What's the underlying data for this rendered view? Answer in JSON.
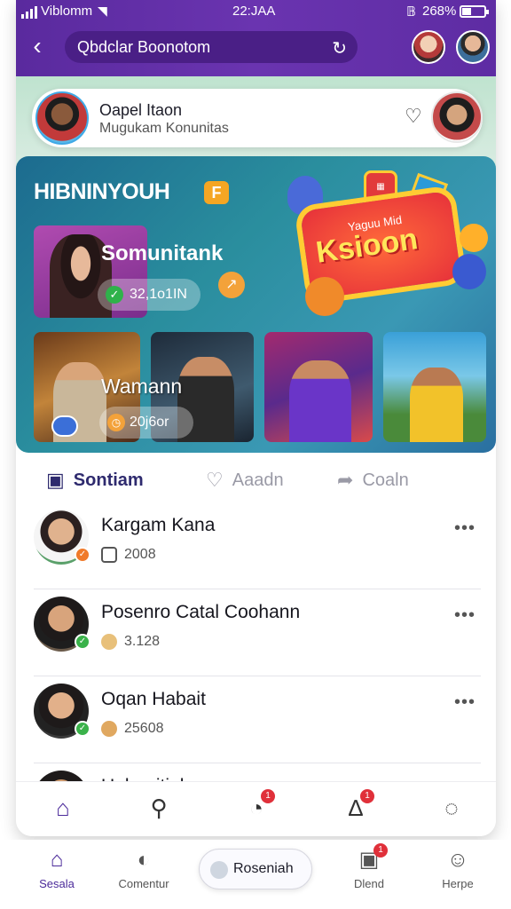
{
  "status": {
    "carrier": "Viblomm",
    "time": "22:JAA",
    "battery": "268%"
  },
  "header": {
    "back_icon": "back-arrow-icon",
    "search_value": "Qbdclar Boonotom",
    "refresh_icon": "refresh-icon"
  },
  "profile_card": {
    "name": "Oapel Itaon",
    "subtitle": "Mugukam Konunitas"
  },
  "banner": {
    "title": "HIBNINYOUH",
    "badge": "F",
    "feature_label": "Somunitank",
    "feature_count": "32,1o1IN",
    "graphic_text": "Ksioon",
    "graphic_subtext": "Yaguu Mid",
    "video_label": "Wamann",
    "video_count": "20j6or"
  },
  "tabs": [
    {
      "label": "Sontiam",
      "icon": "bookmark-icon",
      "active": true
    },
    {
      "label": "Aaadn",
      "icon": "heart-icon",
      "active": false
    },
    {
      "label": "Coaln",
      "icon": "share-icon",
      "active": false
    }
  ],
  "list": [
    {
      "name": "Kargam Kana",
      "meta": "2008",
      "status_color": "#f07a2a"
    },
    {
      "name": "Posenro Catal Coohann",
      "meta": "3.128",
      "status_color": "#3ab24a"
    },
    {
      "name": "Oqan Habait",
      "meta": "25608",
      "status_color": "#3ab24a"
    },
    {
      "name": "Uobunitial",
      "meta": "",
      "status_color": ""
    }
  ],
  "nav_top": [
    {
      "icon": "home-icon",
      "badge": ""
    },
    {
      "icon": "search-icon",
      "badge": ""
    },
    {
      "icon": "notification-icon",
      "badge": "1"
    },
    {
      "icon": "bell-icon",
      "badge": "1"
    },
    {
      "icon": "chat-icon",
      "badge": ""
    }
  ],
  "nav_bottom": [
    {
      "label": "Sesala",
      "icon": "home-icon",
      "badge": ""
    },
    {
      "label": "Comentur",
      "icon": "comment-icon",
      "badge": ""
    },
    {
      "label": "Dlend",
      "icon": "camera-icon",
      "badge": "1"
    },
    {
      "label": "Herpe",
      "icon": "profile-icon",
      "badge": ""
    }
  ],
  "pill_button": {
    "label": "Roseniah"
  },
  "colors": {
    "brand_purple": "#5a2a9e",
    "accent_orange": "#f5a623",
    "badge_red": "#e0303a"
  }
}
